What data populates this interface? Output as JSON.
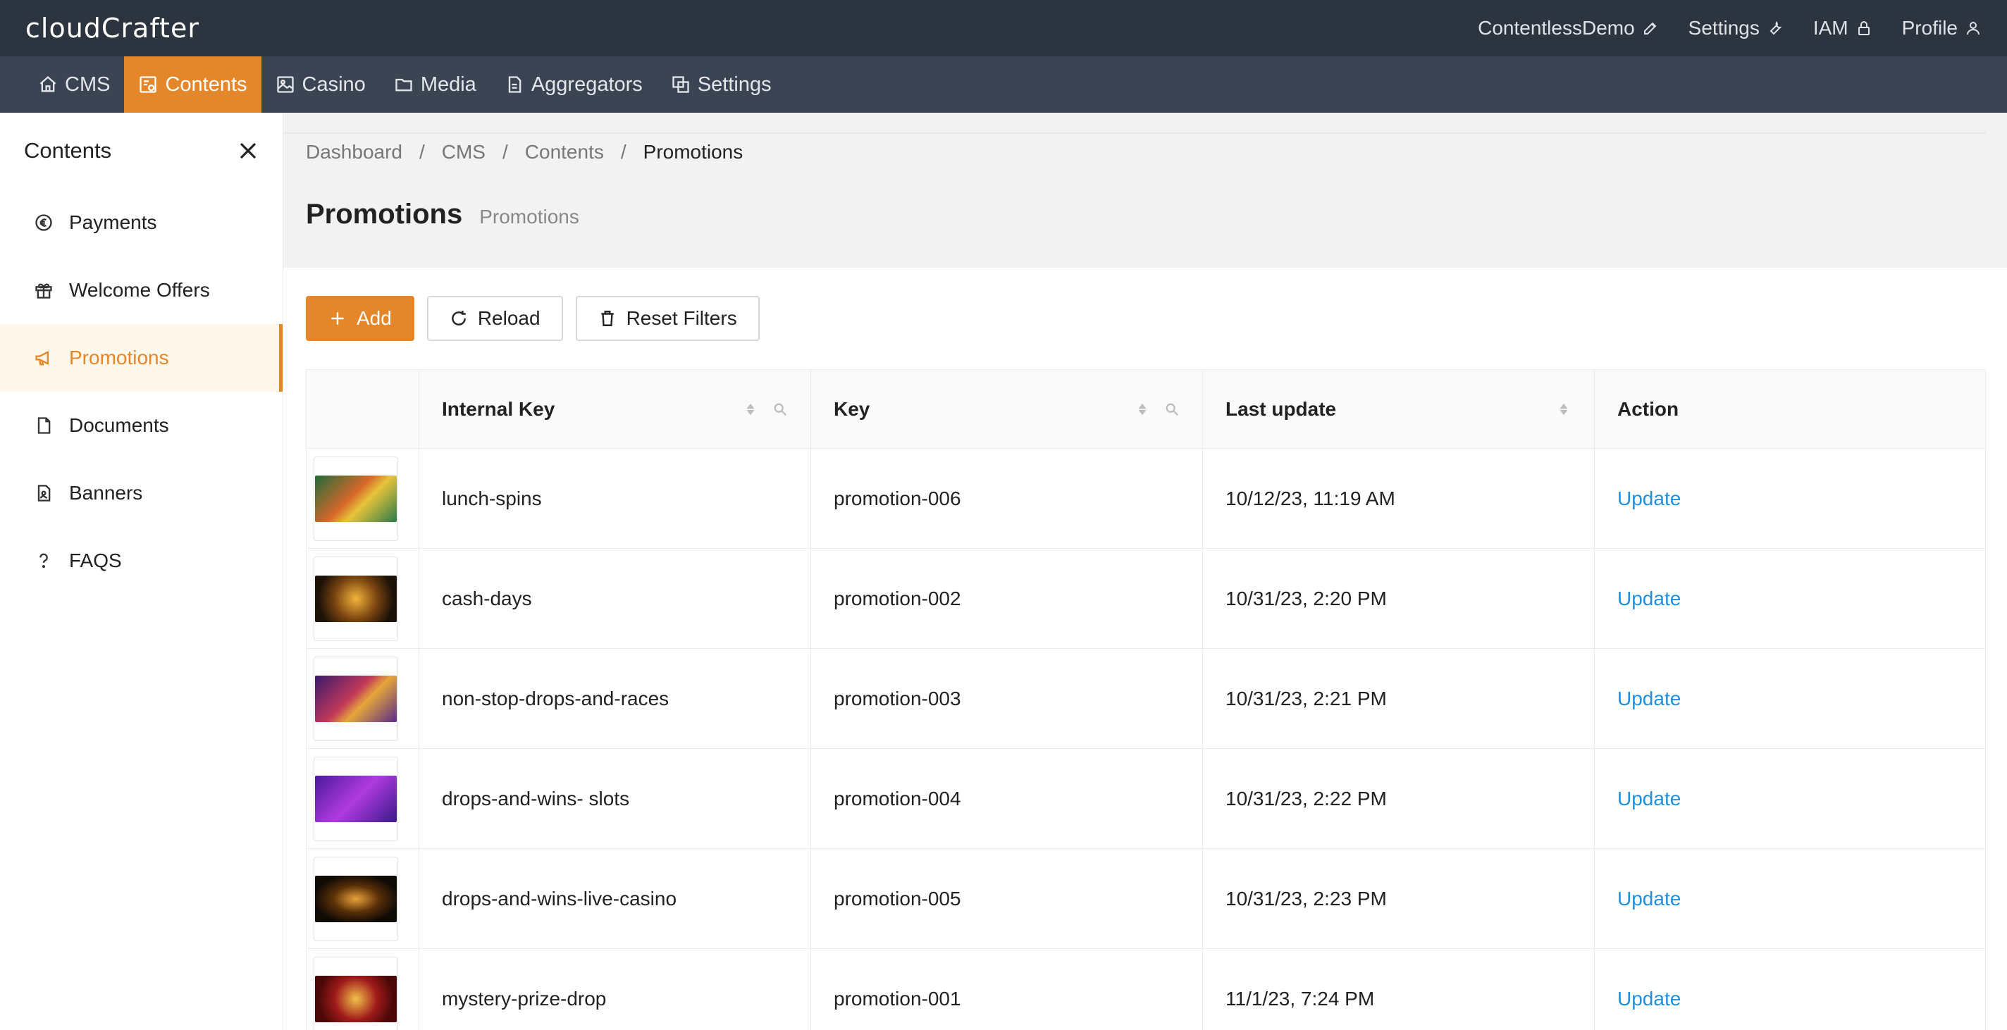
{
  "app": {
    "logo": "cloudCrafter",
    "top_menu": [
      {
        "label": "ContentlessDemo",
        "icon": "edit-icon"
      },
      {
        "label": "Settings",
        "icon": "wrench-icon"
      },
      {
        "label": "IAM",
        "icon": "lock-icon"
      },
      {
        "label": "Profile",
        "icon": "user-icon"
      }
    ]
  },
  "nav": {
    "items": [
      {
        "label": "CMS",
        "icon": "home-icon",
        "active": false
      },
      {
        "label": "Contents",
        "icon": "contents-icon",
        "active": true
      },
      {
        "label": "Casino",
        "icon": "casino-icon",
        "active": false
      },
      {
        "label": "Media",
        "icon": "folder-icon",
        "active": false
      },
      {
        "label": "Aggregators",
        "icon": "file-icon",
        "active": false
      },
      {
        "label": "Settings",
        "icon": "settings-icon",
        "active": false
      }
    ]
  },
  "sidebar": {
    "title": "Contents",
    "items": [
      {
        "label": "Payments",
        "icon": "euro-icon",
        "active": false
      },
      {
        "label": "Welcome Offers",
        "icon": "gift-icon",
        "active": false
      },
      {
        "label": "Promotions",
        "icon": "megaphone-icon",
        "active": true
      },
      {
        "label": "Documents",
        "icon": "document-icon",
        "active": false
      },
      {
        "label": "Banners",
        "icon": "banner-icon",
        "active": false
      },
      {
        "label": "FAQS",
        "icon": "question-icon",
        "active": false
      }
    ]
  },
  "breadcrumb": [
    "Dashboard",
    "CMS",
    "Contents",
    "Promotions"
  ],
  "page": {
    "title": "Promotions",
    "subtitle": "Promotions"
  },
  "toolbar": {
    "add_label": "Add",
    "reload_label": "Reload",
    "reset_label": "Reset Filters"
  },
  "table": {
    "columns": {
      "internal_key": "Internal Key",
      "key": "Key",
      "last_update": "Last update",
      "action": "Action"
    },
    "rows": [
      {
        "internal_key": "lunch-spins",
        "key": "promotion-006",
        "last_update": "10/12/23, 11:19 AM",
        "action": "Update"
      },
      {
        "internal_key": "cash-days",
        "key": "promotion-002",
        "last_update": "10/31/23, 2:20 PM",
        "action": "Update"
      },
      {
        "internal_key": "non-stop-drops-and-races",
        "key": "promotion-003",
        "last_update": "10/31/23, 2:21 PM",
        "action": "Update"
      },
      {
        "internal_key": "drops-and-wins- slots",
        "key": "promotion-004",
        "last_update": "10/31/23, 2:22 PM",
        "action": "Update"
      },
      {
        "internal_key": "drops-and-wins-live-casino",
        "key": "promotion-005",
        "last_update": "10/31/23, 2:23 PM",
        "action": "Update"
      },
      {
        "internal_key": "mystery-prize-drop",
        "key": "promotion-001",
        "last_update": "11/1/23, 7:24 PM",
        "action": "Update"
      }
    ]
  },
  "colors": {
    "accent": "#e3872a",
    "topbar": "#2c3440",
    "navbar": "#3b4452",
    "link": "#1e90e0"
  }
}
